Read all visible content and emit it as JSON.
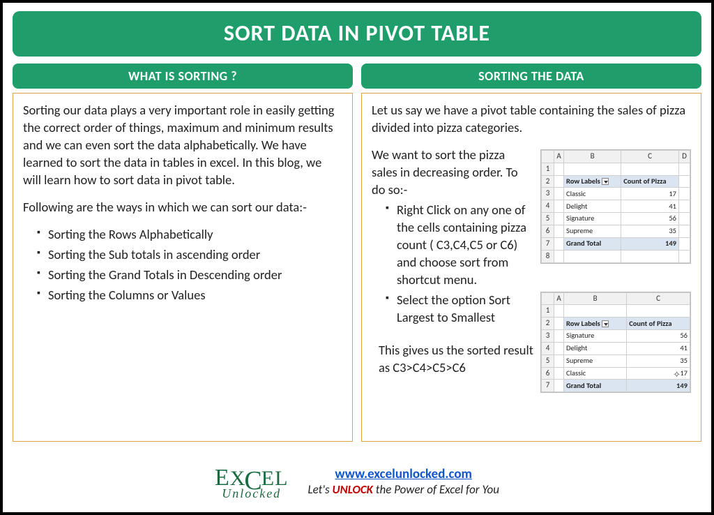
{
  "title": "SORT DATA IN PIVOT TABLE",
  "left": {
    "header": "WHAT IS SORTING ?",
    "para1": "Sorting our data plays a very important role in easily getting the correct order of things, maximum and minimum results and we can even sort the data alphabetically. We have learned to sort the data in tables in excel. In this blog, we will learn how to sort data in pivot table.",
    "para2": "Following are the ways in which we can sort our data:-",
    "bullets": [
      "Sorting the Rows Alphabetically",
      "Sorting the Sub totals in ascending order",
      "Sorting the Grand Totals in Descending order",
      "Sorting the Columns or Values"
    ]
  },
  "right": {
    "header": "SORTING THE DATA",
    "intro": "Let us say we have a pivot table containing the sales of pizza divided into pizza categories.",
    "lead": "We want to sort the pizza sales in decreasing order. To do so:-",
    "steps": [
      "Right Click on any one of the cells containing pizza count ( C3,C4,C5 or C6) and choose sort from shortcut menu.",
      "Select the option Sort Largest to Smallest"
    ],
    "result": "This gives us the sorted result as C3>C4>C5>C6"
  },
  "pivot_cols": {
    "a": "A",
    "b": "B",
    "c": "C",
    "d": "D"
  },
  "pivot_headers": {
    "row_labels": "Row Labels",
    "count": "Count of Pizza",
    "grand_total": "Grand Total"
  },
  "pivot_before": {
    "rows": [
      {
        "label": "Classic",
        "val": "17"
      },
      {
        "label": "Delight",
        "val": "41"
      },
      {
        "label": "Signature",
        "val": "56"
      },
      {
        "label": "Supreme",
        "val": "35"
      }
    ],
    "total": "149"
  },
  "pivot_after": {
    "rows": [
      {
        "label": "Signature",
        "val": "56"
      },
      {
        "label": "Delight",
        "val": "41"
      },
      {
        "label": "Supreme",
        "val": "35"
      },
      {
        "label": "Classic",
        "val": "17"
      }
    ],
    "total": "149"
  },
  "footer": {
    "logo_top": "EX   EL",
    "logo_c": "C",
    "logo_bottom": "Unlocked",
    "link": "www.excelunlocked.com",
    "tag_pre": "Let's ",
    "tag_unlock": "UNLOCK",
    "tag_post": " the Power of Excel for You"
  }
}
